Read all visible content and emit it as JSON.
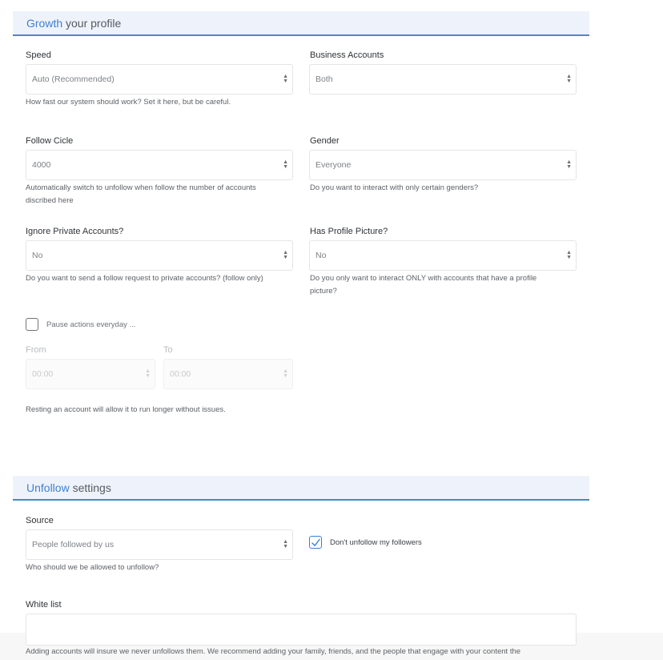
{
  "growth": {
    "title_accent": "Growth",
    "title_rest": " your profile",
    "speed": {
      "label": "Speed",
      "value": "Auto (Recommended)",
      "help": "How fast our system should work? Set it here, but be careful."
    },
    "business_accounts": {
      "label": "Business Accounts",
      "value": "Both"
    },
    "follow_cicle": {
      "label": "Follow Cicle",
      "value": "4000",
      "help_line1": "Automatically switch to unfollow when follow the number of accounts",
      "help_line2": "discribed here"
    },
    "gender": {
      "label": "Gender",
      "value": "Everyone",
      "help": "Do you want to interact with only certain genders?"
    },
    "ignore_private": {
      "label": "Ignore Private Accounts?",
      "value": "No",
      "help": "Do you want to send a follow request to private accounts? (follow only)"
    },
    "profile_picture": {
      "label": "Has Profile Picture?",
      "value": "No",
      "help_line1": "Do you only want to interact ONLY with accounts that have a profile",
      "help_line2": "picture?"
    },
    "pause": {
      "label": "Pause actions everyday ...",
      "checked": false
    },
    "from": {
      "label": "From",
      "value": "00:00"
    },
    "to": {
      "label": "To",
      "value": "00:00"
    },
    "resting_help": "Resting an account will allow it to run longer without issues."
  },
  "unfollow": {
    "title_accent": "Unfollow",
    "title_rest": " settings",
    "source": {
      "label": "Source",
      "value": "People followed by us",
      "help": "Who should we be allowed to unfollow?"
    },
    "dont_unfollow": {
      "label": "Don't unfollow my followers",
      "checked": true
    },
    "whitelist": {
      "label": "White list",
      "help": "Adding accounts will insure we never unfollows them. We recommend adding your family, friends, and the people that engage with your content the"
    }
  },
  "colors": {
    "accent": "#3d7fd2",
    "header_bg": "#eef3fb",
    "header_border": "#4a86d4"
  }
}
